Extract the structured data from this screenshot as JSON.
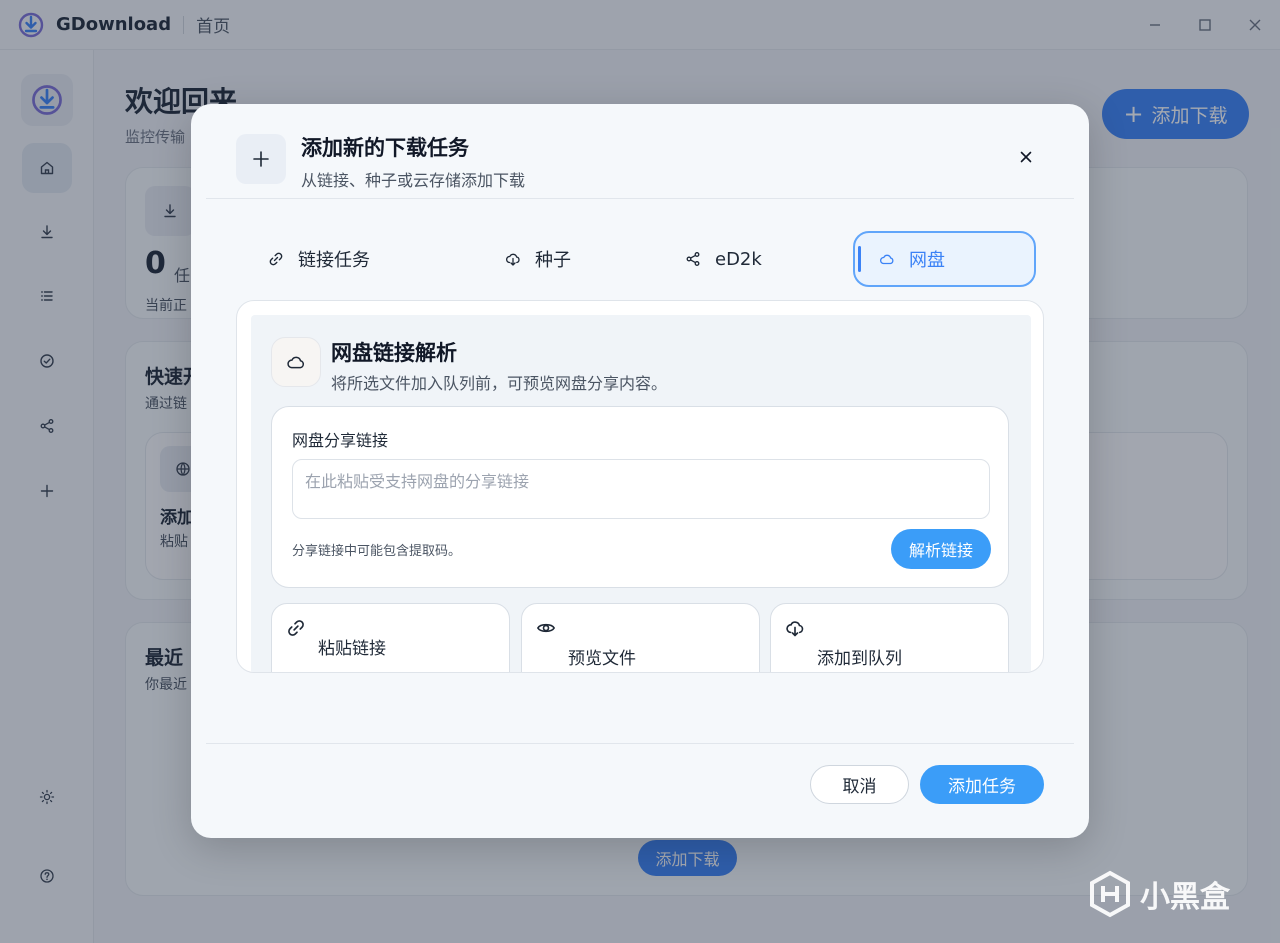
{
  "app": {
    "name": "GDownload",
    "page": "首页"
  },
  "main": {
    "title": "欢迎回来",
    "subtitle": "监控传输",
    "add_download": "添加下载",
    "stats_value": "0",
    "stats_unit": "任",
    "stats_caption": "当前正",
    "quick_title": "快速开",
    "quick_sub": "通过链",
    "quick_card_title": "添加",
    "quick_card_sub": "粘贴",
    "recent_title": "最近",
    "recent_sub": "你最近",
    "bottom_add": "添加下载"
  },
  "dialog": {
    "title": "添加新的下载任务",
    "subtitle": "从链接、种子或云存储添加下载",
    "tabs": [
      {
        "label": "链接任务",
        "icon": "link-icon"
      },
      {
        "label": "种子",
        "icon": "cloud-download-icon"
      },
      {
        "label": "eD2k",
        "icon": "share-icon"
      },
      {
        "label": "网盘",
        "icon": "cloud-icon",
        "active": true
      }
    ],
    "section_title": "网盘链接解析",
    "section_sub": "将所选文件加入队列前，可预览网盘分享内容。",
    "field_label": "网盘分享链接",
    "input_placeholder": "在此粘贴受支持网盘的分享链接",
    "input_value": "",
    "hint": "分享链接中可能包含提取码。",
    "parse_button": "解析链接",
    "features": [
      {
        "label": "粘贴链接",
        "icon": "link-icon"
      },
      {
        "label": "预览文件",
        "icon": "eye-icon"
      },
      {
        "label": "添加到队列",
        "icon": "cloud-download-icon"
      }
    ],
    "cancel": "取消",
    "submit": "添加任务"
  },
  "watermark": "小黑盒",
  "colors": {
    "accent": "#3b9df8",
    "accent_dark": "#3b82f6",
    "tab_active_bg": "#eaf3fe"
  }
}
